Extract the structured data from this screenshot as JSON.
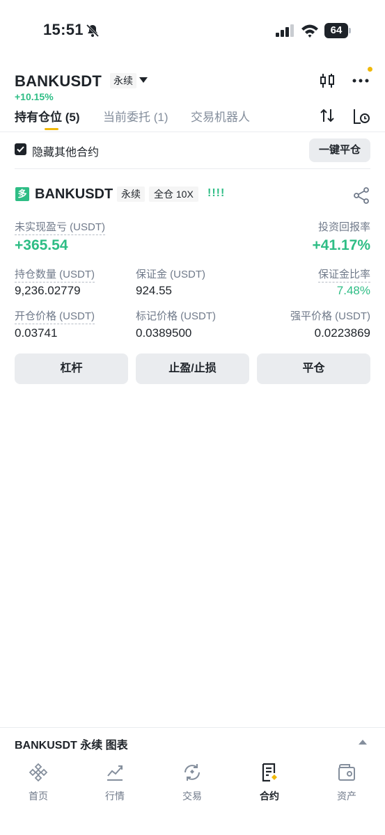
{
  "status_bar": {
    "time": "15:51",
    "battery": "64"
  },
  "header": {
    "symbol": "BANKUSDT",
    "contract_type": "永续",
    "change": "+10.15%"
  },
  "tabs": [
    {
      "label": "持有仓位 (5)"
    },
    {
      "label": "当前委托 (1)"
    },
    {
      "label": "交易机器人"
    }
  ],
  "filter": {
    "hide_other_label": "隐藏其他合约",
    "close_all_label": "一键平仓"
  },
  "position": {
    "side": "多",
    "symbol": "BANKUSDT",
    "contract_type": "永续",
    "margin_mode": "全仓 10X",
    "strength_bars": "!!!!",
    "unrealized_pnl_label": "未实现盈亏 (USDT)",
    "unrealized_pnl": "+365.54",
    "roi_label": "投资回报率",
    "roi": "+41.17%",
    "size_label": "持仓数量 (USDT)",
    "size": "9,236.02779",
    "margin_label": "保证金 (USDT)",
    "margin": "924.55",
    "margin_ratio_label": "保证金比率",
    "margin_ratio": "7.48%",
    "entry_price_label": "开仓价格 (USDT)",
    "entry_price": "0.03741",
    "mark_price_label": "标记价格 (USDT)",
    "mark_price": "0.0389500",
    "liq_price_label": "强平价格 (USDT)",
    "liq_price": "0.0223869",
    "buttons": {
      "leverage": "杠杆",
      "tpsl": "止盈/止损",
      "close": "平仓"
    }
  },
  "chart_bar": {
    "label": "BANKUSDT 永续 图表"
  },
  "bottom_nav": [
    {
      "label": "首页",
      "icon": "home-icon"
    },
    {
      "label": "行情",
      "icon": "markets-icon"
    },
    {
      "label": "交易",
      "icon": "trade-icon"
    },
    {
      "label": "合约",
      "icon": "futures-icon"
    },
    {
      "label": "资产",
      "icon": "wallet-icon"
    }
  ],
  "colors": {
    "accent": "#f0b90b",
    "up": "#2ebd85",
    "text": "#1e2329",
    "muted": "#707a8a"
  }
}
